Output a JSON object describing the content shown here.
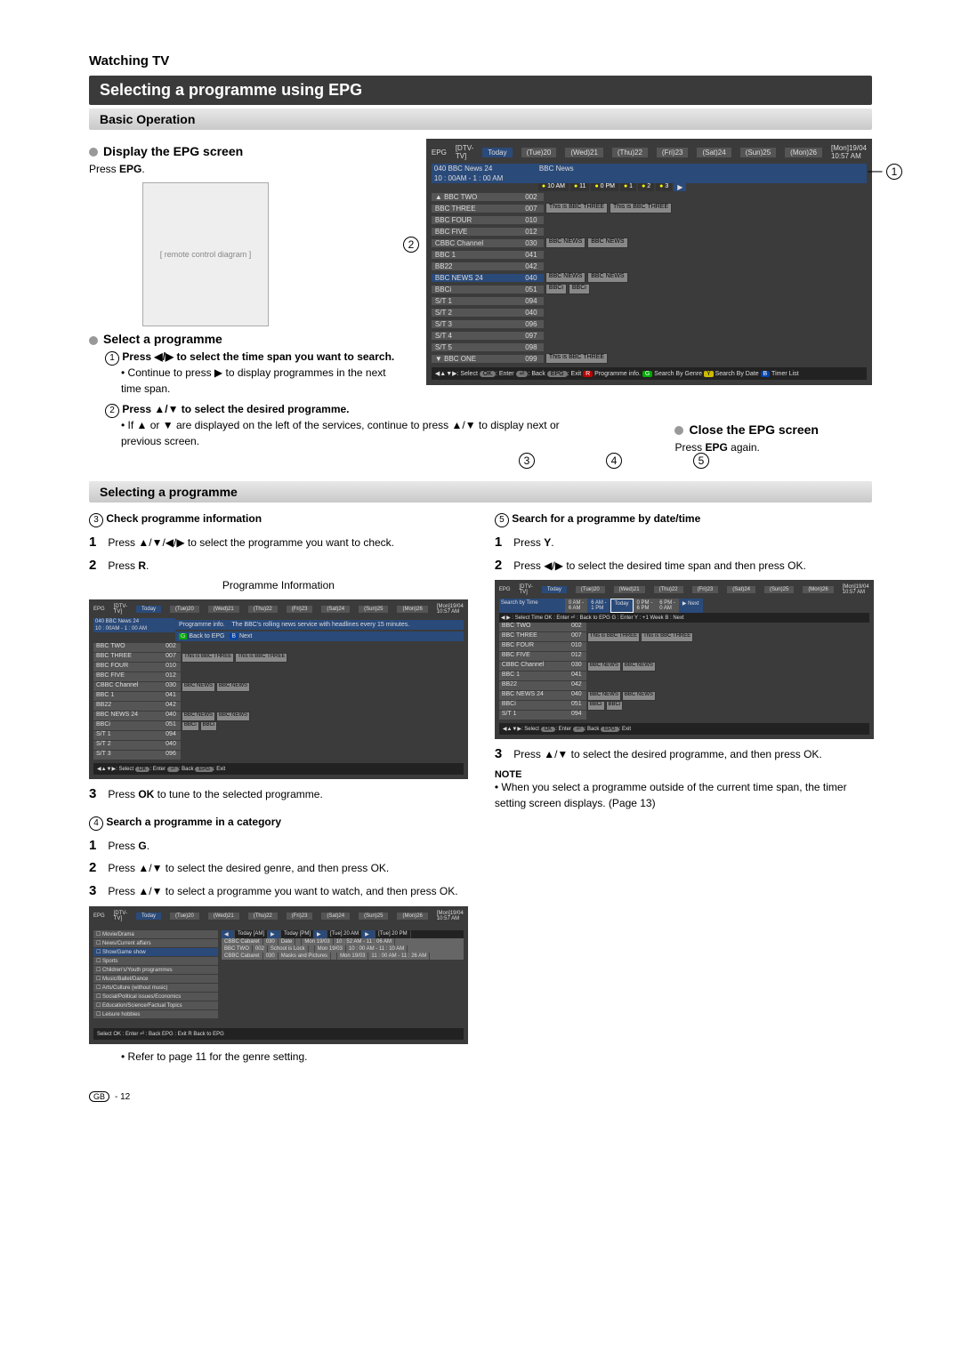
{
  "page": {
    "section_title": "Watching TV",
    "main_title": "Selecting a programme using EPG",
    "basic_op": "Basic Operation",
    "display_epg_h": "Display the EPG screen",
    "press_epg": "Press EPG.",
    "select_prog_h": "Select a programme",
    "step1_h": "Press ◀/▶ to select the time span you want to search.",
    "step1_bullet": "Continue to press ▶ to display programmes in the next time span.",
    "step2_h": "Press ▲/▼ to select the desired programme.",
    "step2_bullet": "If ▲ or ▼ are displayed on the left of the services, continue to press ▲/▼ to display next or previous screen.",
    "close_epg_h": "Close the EPG screen",
    "close_epg_body": "Press EPG again.",
    "selecting_prog_bar": "Selecting a programme",
    "sec3_h": "Check programme information",
    "sec3_s1": "Press ▲/▼/◀/▶ to select the programme you want to check.",
    "sec3_s2": "Press R.",
    "prog_info_caption": "Programme Information",
    "sec3_s3": "Press OK to tune to the selected programme.",
    "sec4_h": "Search a programme in a category",
    "sec4_s1": "Press G.",
    "sec4_s2": "Press ▲/▼ to select the desired genre, and then press OK.",
    "sec4_s3": "Press ▲/▼ to select a programme you want to watch, and then press OK.",
    "sec4_note": "Refer to page 11 for the genre setting.",
    "sec5_h": "Search for a programme by date/time",
    "sec5_s1": "Press Y.",
    "sec5_s2": "Press ◀/▶ to select the desired time span and then press OK.",
    "sec5_s3": "Press ▲/▼ to select the desired programme, and then press OK.",
    "note_label": "NOTE",
    "note_body": "When you select a programme outside of the current time span, the timer setting screen displays. (Page 13)",
    "footer": "- 12",
    "footer_badge": "GB"
  },
  "epg_main": {
    "title": "EPG",
    "mode": "[DTV-TV]",
    "days": [
      "Today",
      "(Tue)20",
      "(Wed)21",
      "(Thu)22",
      "(Fri)23",
      "(Sat)24",
      "(Sun)25",
      "(Mon)26"
    ],
    "datetime": "[Mon]19/04 10:57 AM",
    "current_ch": "040   BBC News 24",
    "current_time": "10 : 00AM - 1 : 00 AM",
    "current_prog": "BBC News",
    "time_slots": [
      "10 AM",
      "11",
      "0 PM",
      "1",
      "2",
      "3"
    ],
    "channels": [
      {
        "name": "BBC TWO",
        "num": "002",
        "progs": []
      },
      {
        "name": "BBC THREE",
        "num": "007",
        "progs": [
          "This is BBC THREE",
          "This is BBC THREE"
        ]
      },
      {
        "name": "BBC FOUR",
        "num": "010",
        "progs": []
      },
      {
        "name": "BBC FIVE",
        "num": "012",
        "progs": []
      },
      {
        "name": "CBBC Channel",
        "num": "030",
        "progs": [
          "BBC NEWS",
          "BBC NEWS"
        ]
      },
      {
        "name": "BBC 1",
        "num": "041",
        "progs": []
      },
      {
        "name": "BB22",
        "num": "042",
        "progs": []
      },
      {
        "name": "BBC NEWS 24",
        "num": "040",
        "progs": [
          "BBC NEWS",
          "BBC NEWS"
        ]
      },
      {
        "name": "BBCi",
        "num": "051",
        "progs": [
          "BBCi",
          "BBCi"
        ]
      },
      {
        "name": "S/T 1",
        "num": "094",
        "progs": []
      },
      {
        "name": "S/T 2",
        "num": "040",
        "progs": []
      },
      {
        "name": "S/T 3",
        "num": "096",
        "progs": []
      },
      {
        "name": "S/T 4",
        "num": "097",
        "progs": []
      },
      {
        "name": "S/T 5",
        "num": "098",
        "progs": []
      },
      {
        "name": "BBC ONE",
        "num": "099",
        "progs": [
          "This is BBC THREE"
        ]
      }
    ],
    "helpbar": {
      "select": ": Select",
      "ok": "OK",
      "enter": ": Enter",
      "back_key": "⏎",
      "back": ": Back",
      "epg": "EPG",
      "exit": ": Exit",
      "r": "R",
      "r_txt": "Programme info.",
      "g": "G",
      "g_txt": "Search By Genre",
      "y": "Y",
      "y_txt": "Search By Date",
      "b": "B",
      "b_txt": "Timer List"
    }
  },
  "epg_info": {
    "info_label": "Programme info.",
    "back_label": "Back to EPG",
    "next_label": "Next",
    "desc": "The BBC's rolling news service with headlines every 15 minutes."
  },
  "epg_time": {
    "title": "Search by Time",
    "col1": "0 AM -\n6 AM",
    "col2": "6 AM -\n1 PM",
    "today": "Today",
    "col3": "0 PM -\n6 PM",
    "col4": "6 PM -\n0 AM",
    "next": "▶ Next",
    "help": "◀ ▶ : Select Time    OK : Enter    ⏎ : Back to EPG    G : Enter    Y : +1 Week    B : Next"
  },
  "epg_genre": {
    "genres": [
      "Movie/Drama",
      "News/Current affairs",
      "Show/Game show",
      "Sports",
      "Children's/Youth programmes",
      "Music/Ballet/Dance",
      "Arts/Culture (without music)",
      "Social/Political issues/Economics",
      "Education/Science/Factual Topics",
      "Leisure hobbies"
    ],
    "header": [
      "",
      "Today [AM]",
      "",
      "Today [PM]",
      "",
      "[Tue] 20 AM",
      "",
      "[Tue] 20 PM"
    ],
    "rows": [
      [
        "CBBC Cabaret",
        "030",
        "Date",
        "",
        "Mon 19/03",
        "10 : 52 AM - 11 : 06 AM"
      ],
      [
        "BBC TWO",
        "002",
        "School is Lock",
        "",
        "Mon 19/03",
        "10 : 00 AM - 11 : 10 AM"
      ],
      [
        "CBBC Cabaret",
        "030",
        "Masks and Pictures",
        "",
        "Mon 19/03",
        "11 : 00 AM - 11 : 26 AM"
      ]
    ],
    "help": "Select  OK : Enter  ⏎ : Back  EPG : Exit    R  Back to EPG"
  }
}
